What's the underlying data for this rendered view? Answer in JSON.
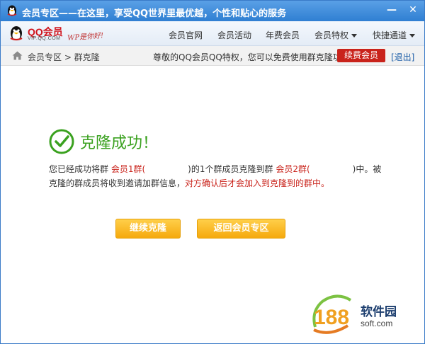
{
  "window": {
    "title": "会员专区——在这里，享受QQ世界里最优越，个性和贴心的服务",
    "minimize_symbol": "—",
    "close_symbol": "✕"
  },
  "brand": {
    "name": "QQ会员",
    "site": "VIP.QQ.COM",
    "slogan": "WP是你好!"
  },
  "nav": {
    "items": [
      "会员官网",
      "会员活动",
      "年费会员",
      "会员特权",
      "快捷通道"
    ]
  },
  "breadcrumb": {
    "path": "会员专区 > 群克隆",
    "notice": "尊敬的QQ会员QQ特权，您可以免费使用群克隆功能。",
    "renew_label": "续费会员",
    "logout_label": "[退出]"
  },
  "result": {
    "title": "克隆成功！",
    "line1_a": "您已经成功将群",
    "group1": "会员1群(",
    "line1_b": ")的1个群成员克隆到群",
    "group2": "会员2群(",
    "line1_c": ")中。被",
    "line2_a": "克隆的群成员将收到邀请加群信息，",
    "line2_b": "对方确认后才会加入到克隆到的群中。"
  },
  "buttons": {
    "continue_label": "继续克隆",
    "back_label": "返回会员专区"
  },
  "watermark": {
    "number": "188",
    "name": "软件园",
    "url": "soft.com"
  },
  "colors": {
    "titlebar": "#2f7fd2",
    "success": "#3aa11f",
    "accent_red": "#c9231b",
    "button_yellow": "#f5a90d"
  }
}
